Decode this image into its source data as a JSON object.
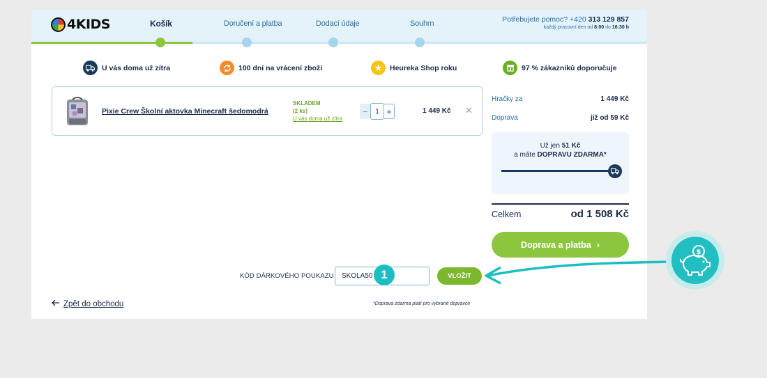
{
  "logo": {
    "text": "4KIDS"
  },
  "steps": [
    {
      "label": "Košík",
      "active": true
    },
    {
      "label": "Doručení a platba",
      "active": false
    },
    {
      "label": "Dodací údaje",
      "active": false
    },
    {
      "label": "Souhrn",
      "active": false
    }
  ],
  "help": {
    "question": "Potřebujete pomoc?",
    "phone_prefix": "+420",
    "phone": "313 129 857",
    "hours_text": "každý pracovní den od",
    "hours_from": "8:00",
    "hours_sep": "do",
    "hours_to": "16:30 h"
  },
  "benefits": [
    {
      "label": "U vás doma už zítra",
      "icon": "truck-icon",
      "color": "#1b3a5b"
    },
    {
      "label": "100 dní na vrácení zboží",
      "icon": "refresh-icon",
      "color": "#f28c28"
    },
    {
      "label": "Heureka Shop roku",
      "icon": "star-icon",
      "color": "#f5c518"
    },
    {
      "label": "97 % zákazníků doporučuje",
      "icon": "shop-icon",
      "color": "#6ab023"
    }
  ],
  "cart_item": {
    "name": "Pixie Crew Školní aktovka Minecraft šedomodrá",
    "stock_status": "SKLADEM",
    "stock_count": "(2 ks)",
    "delivery": "U vás doma už zítra",
    "quantity": "1",
    "price": "1 449 Kč"
  },
  "summary": {
    "toys_label": "Hračky za",
    "toys_value": "1 449 Kč",
    "shipping_label": "Doprava",
    "shipping_value": "již od 59 Kč",
    "free_prefix": "Už jen",
    "free_amount": "51 Kč",
    "free_mid": "a máte",
    "free_bold": "DOPRAVU ZDARMA*",
    "free_progress": 0.97,
    "total_label": "Celkem",
    "total_value": "od 1 508 Kč",
    "checkout_label": "Doprava a platba"
  },
  "voucher": {
    "label": "KÓD DÁRKOVÉHO POUKAZU",
    "value": "ŠKOLA50",
    "button": "VLOŽIT"
  },
  "footer": {
    "back_label": "Zpět do obchodu",
    "footnote": "*Doprava zdarma platí pro vybrané dopravce"
  },
  "tutorial": {
    "badge": "1",
    "icon": "piggy-bank-icon"
  },
  "colors": {
    "accent_green": "#8cc63e",
    "navy": "#1b2b4b",
    "link_blue": "#2a6fa8",
    "header_bg": "#e3f3f9",
    "tutorial_teal": "#1bbfc1"
  }
}
